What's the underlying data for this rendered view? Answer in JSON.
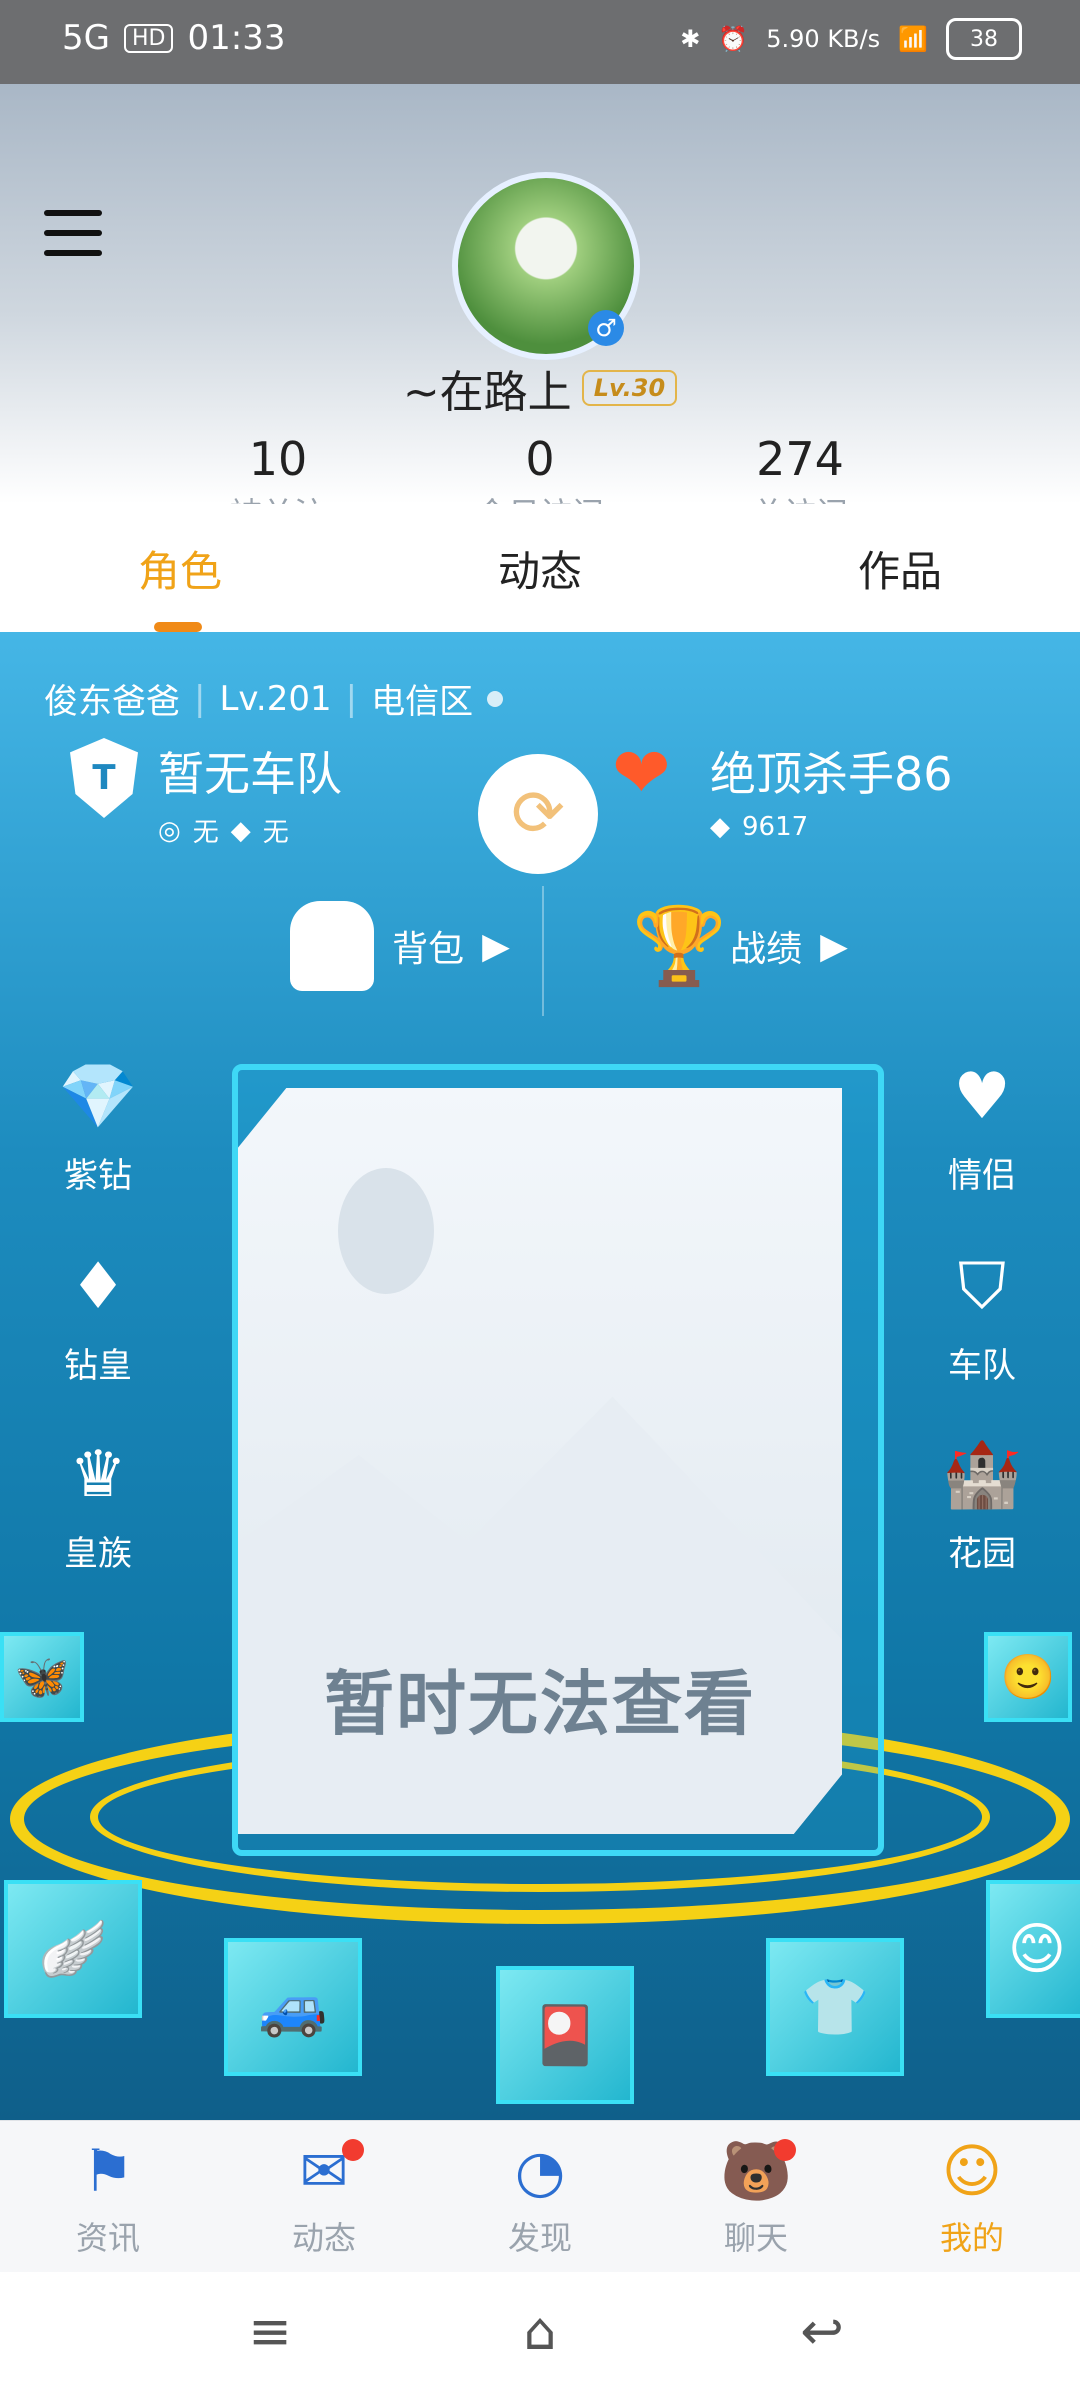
{
  "status_bar": {
    "network": "5G",
    "hd": "HD",
    "time": "01:33",
    "speed": "5.90 KB/s",
    "battery": "38"
  },
  "profile": {
    "nickname": "~在路上",
    "level_badge": "Lv.30",
    "stats": [
      {
        "value": "10",
        "label": "被关注"
      },
      {
        "value": "0",
        "label": "今日访问"
      },
      {
        "value": "274",
        "label": "总访问"
      }
    ]
  },
  "tabs": [
    {
      "label": "角色",
      "active": true
    },
    {
      "label": "动态",
      "active": false
    },
    {
      "label": "作品",
      "active": false
    }
  ],
  "game": {
    "role_name": "俊东爸爸",
    "role_level": "Lv.201",
    "server": "电信区",
    "team_title": "暂无车队",
    "team_meta_left": "无",
    "team_meta_right": "无",
    "killer_title": "绝顶杀手86",
    "killer_score": "9617",
    "toolbar": [
      {
        "label": "背包"
      },
      {
        "label": "战绩"
      }
    ],
    "left_items": [
      {
        "label": "紫钻",
        "icon": "diamond-icon"
      },
      {
        "label": "钻皇",
        "icon": "diamond-crown-icon"
      },
      {
        "label": "皇族",
        "icon": "crown-icon"
      }
    ],
    "right_items": [
      {
        "label": "情侣",
        "icon": "heart-crown-icon"
      },
      {
        "label": "车队",
        "icon": "team-shield-icon"
      },
      {
        "label": "花园",
        "icon": "castle-icon"
      }
    ],
    "card_text": "暂时无法查看"
  },
  "bottom_nav": [
    {
      "label": "资讯",
      "icon": "flag-icon",
      "active": false,
      "badge": false
    },
    {
      "label": "动态",
      "icon": "mail-icon",
      "active": false,
      "badge": true
    },
    {
      "label": "发现",
      "icon": "speedometer-icon",
      "active": false,
      "badge": false
    },
    {
      "label": "聊天",
      "icon": "bear-icon",
      "active": false,
      "badge": true
    },
    {
      "label": "我的",
      "icon": "avatar-icon",
      "active": true,
      "badge": false
    }
  ],
  "colors": {
    "accent": "#f0a318",
    "panel_top": "#45b6e6",
    "panel_bottom": "#0f5f8a"
  }
}
